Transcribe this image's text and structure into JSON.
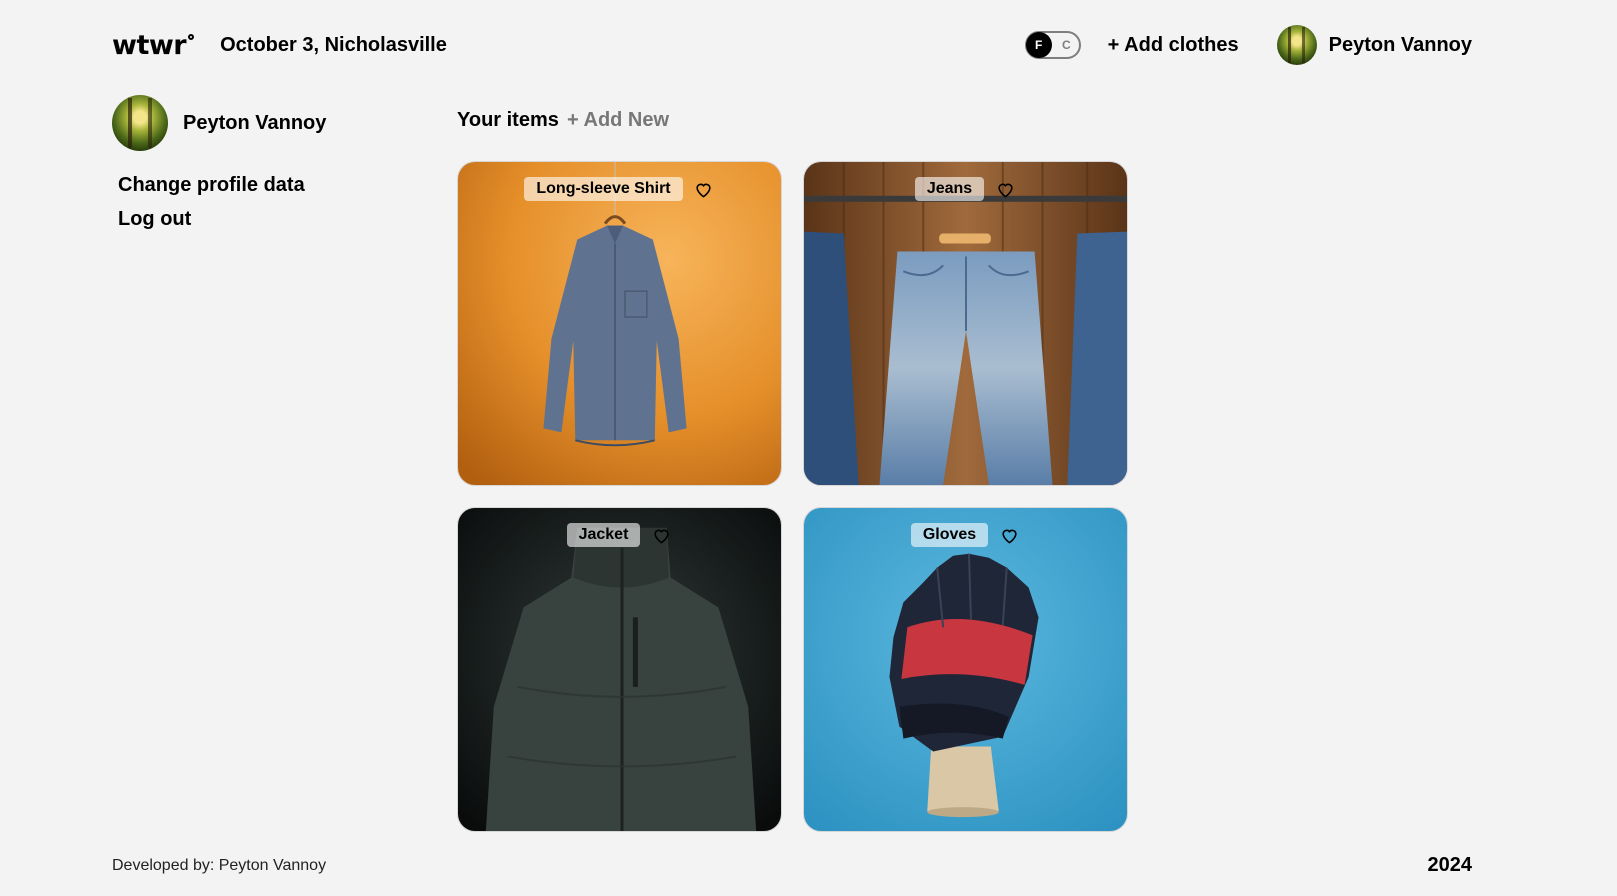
{
  "header": {
    "logo": "wtwr",
    "date_location": "October 3, Nicholasville",
    "toggle": {
      "active": "F",
      "inactive": "C"
    },
    "add_clothes_label": "+ Add clothes",
    "username": "Peyton Vannoy"
  },
  "sidebar": {
    "username": "Peyton Vannoy",
    "links": [
      {
        "label": "Change profile data"
      },
      {
        "label": "Log out"
      }
    ]
  },
  "main": {
    "section_title": "Your items",
    "add_new_label": "+ Add New",
    "items": [
      {
        "name": "Long-sleeve Shirt",
        "image": "shirt-photo"
      },
      {
        "name": "Jeans",
        "image": "jeans-photo"
      },
      {
        "name": "Jacket",
        "image": "jacket-photo"
      },
      {
        "name": "Gloves",
        "image": "gloves-photo"
      }
    ]
  },
  "footer": {
    "developer": "Developed by: Peyton Vannoy",
    "year": "2024"
  },
  "colors": {
    "background": "#f3f3f3",
    "text": "#000000",
    "muted": "#777777"
  }
}
